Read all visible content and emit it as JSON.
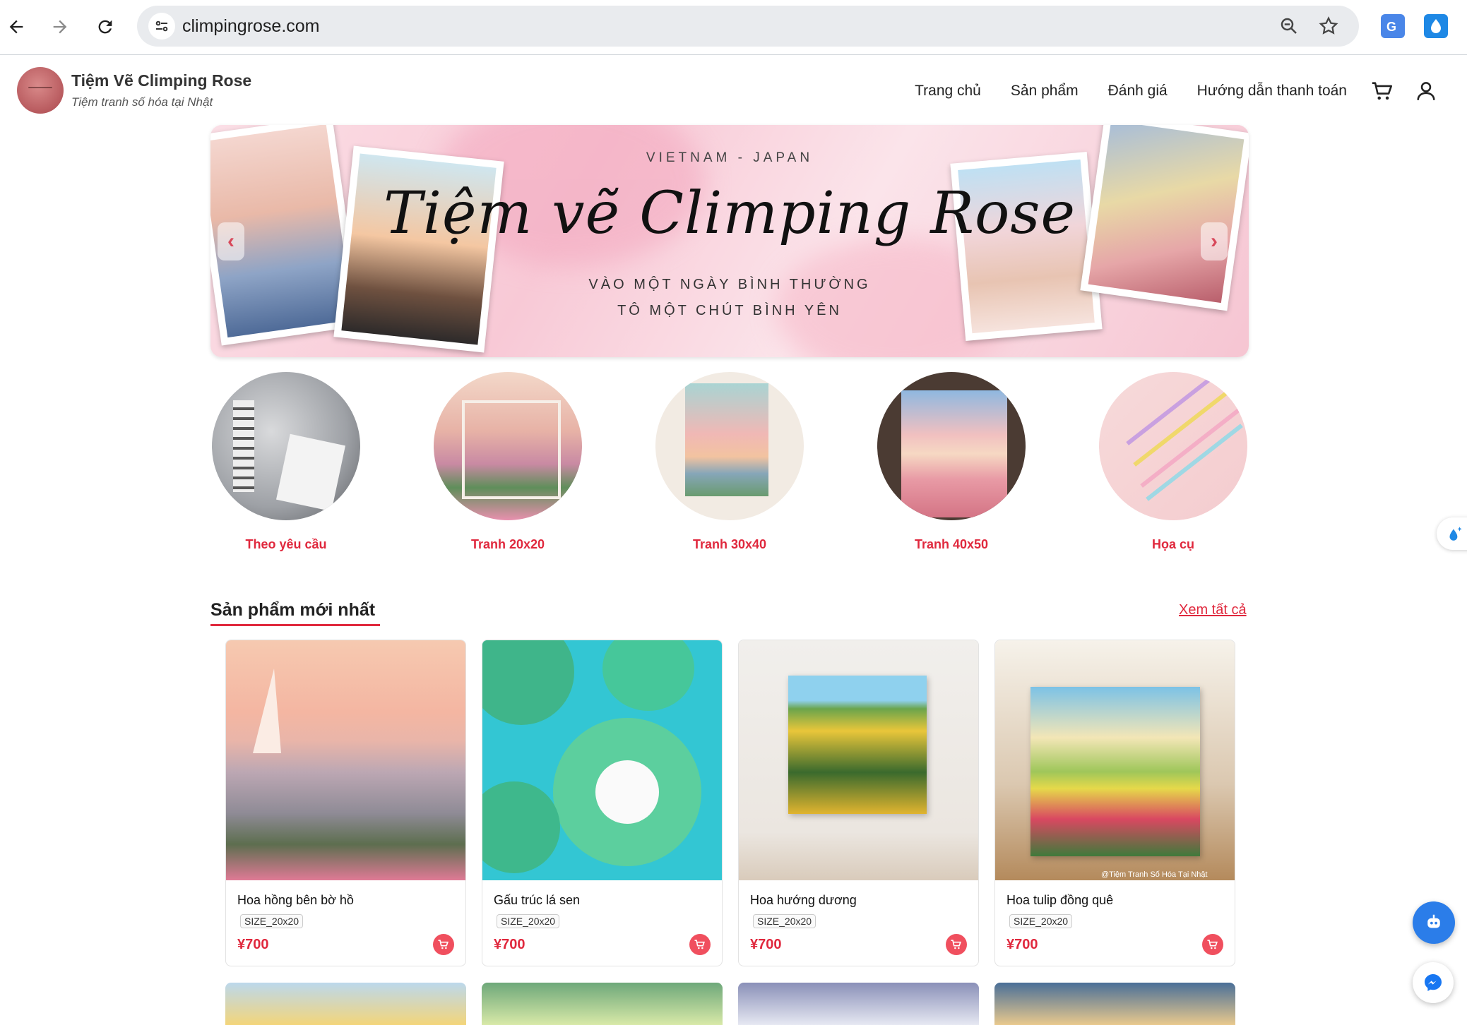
{
  "browser": {
    "url": "climpingrose.com",
    "icons": [
      "back-arrow-icon",
      "forward-arrow-icon",
      "reload-icon",
      "site-info-icon",
      "zoom-icon",
      "star-icon",
      "translate-extension-icon",
      "drop-extension-icon"
    ]
  },
  "header": {
    "brand_title": "Tiệm Vẽ Climping Rose",
    "brand_subtitle": "Tiệm tranh số hóa tại Nhật",
    "nav": [
      "Trang chủ",
      "Sản phẩm",
      "Đánh giá",
      "Hướng dẫn thanh toán"
    ],
    "icons": [
      "cart-icon",
      "user-icon"
    ]
  },
  "banner": {
    "top_text": "VIETNAM - JAPAN",
    "title": "Tiệm vẽ Climping Rose",
    "line1": "VÀO MỘT NGÀY BÌNH THƯỜNG",
    "line2": "TÔ MỘT CHÚT BÌNH YÊN"
  },
  "categories": [
    {
      "label": "Theo yêu cầu"
    },
    {
      "label": "Tranh 20x20"
    },
    {
      "label": "Tranh 30x40"
    },
    {
      "label": "Tranh 40x50"
    },
    {
      "label": "Họa cụ"
    }
  ],
  "latest": {
    "title": "Sản phẩm mới nhất",
    "see_all": "Xem tất cả",
    "products": [
      {
        "name": "Hoa hồng bên bờ hồ",
        "size": "SIZE_20x20",
        "price": "¥700"
      },
      {
        "name": "Gấu trúc lá sen",
        "size": "SIZE_20x20",
        "price": "¥700"
      },
      {
        "name": "Hoa hướng dương",
        "size": "SIZE_20x20",
        "price": "¥700"
      },
      {
        "name": "Hoa tulip đồng quê",
        "size": "SIZE_20x20",
        "price": "¥700"
      }
    ],
    "watermark": "@Tiệm Tranh Số Hóa Tại Nhật"
  },
  "colors": {
    "accent": "#e0283d",
    "chat": "#2b7de9"
  }
}
